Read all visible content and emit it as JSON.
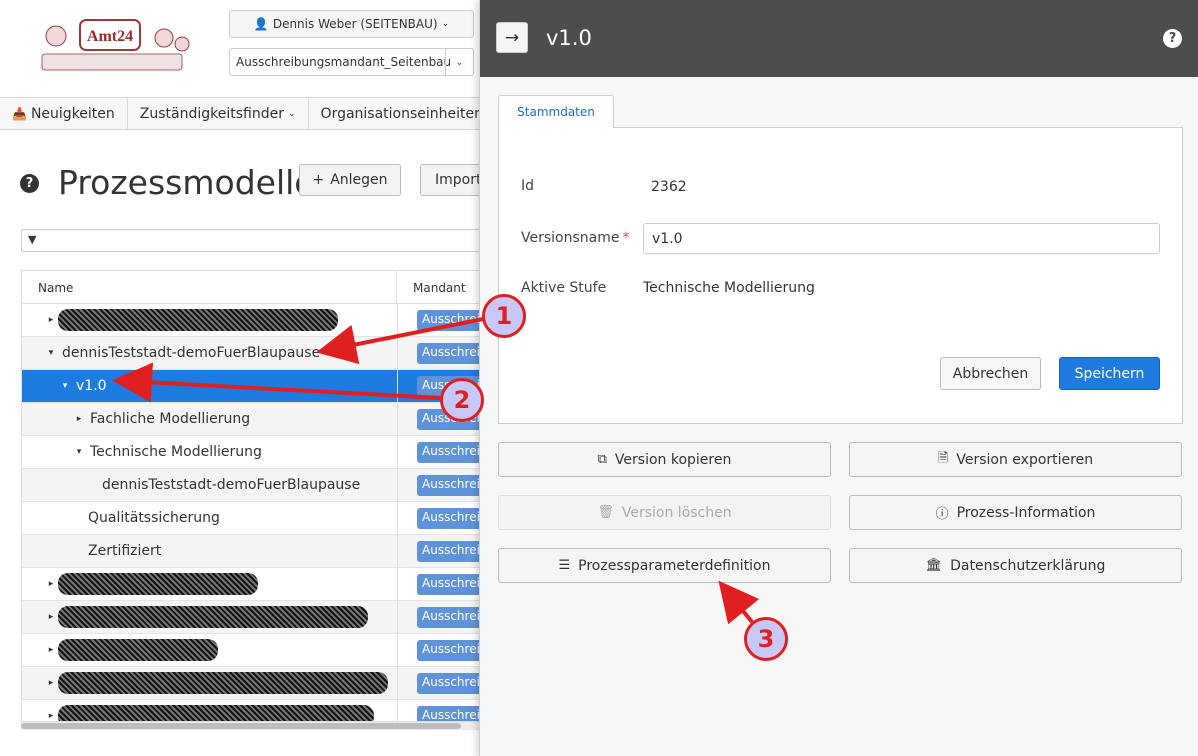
{
  "header": {
    "user_label": "Dennis Weber (SEITENBAU)",
    "mandant_value": "Ausschreibungsmandant_Seitenbau",
    "logo_text": "Amt24"
  },
  "nav": {
    "items": [
      {
        "label": "Neuigkeiten"
      },
      {
        "label": "Zuständigkeitsfinder"
      },
      {
        "label": "Organisationseinheiten"
      }
    ]
  },
  "page": {
    "title": "Prozessmodelle",
    "anlegen_label": "Anlegen",
    "import_label": "Import"
  },
  "tree": {
    "col_name": "Name",
    "col_mandant": "Mandant",
    "badge_label": "Ausschreibungsmandant",
    "rows": [
      {
        "label": "",
        "toggle": "▸"
      },
      {
        "label": "dennisTeststadt-demoFuerBlaupause",
        "toggle": "▾"
      },
      {
        "label": "v1.0",
        "toggle": "▾"
      },
      {
        "label": "Fachliche Modellierung",
        "toggle": "▸"
      },
      {
        "label": "Technische Modellierung",
        "toggle": "▾"
      },
      {
        "label": "dennisTeststadt-demoFuerBlaupause",
        "toggle": ""
      },
      {
        "label": "Qualitätssicherung",
        "toggle": ""
      },
      {
        "label": "Zertifiziert",
        "toggle": ""
      }
    ]
  },
  "panel": {
    "title": "v1.0",
    "tab_label": "Stammdaten",
    "id_label": "Id",
    "id_value": "2362",
    "versionsname_label": "Versionsname",
    "versionsname_value": "v1.0",
    "stufe_label": "Aktive Stufe",
    "stufe_value": "Technische Modellierung",
    "cancel_label": "Abbrechen",
    "save_label": "Speichern",
    "actions": {
      "kopieren": "Version kopieren",
      "exportieren": "Version exportieren",
      "loeschen": "Version löschen",
      "info": "Prozess-Information",
      "parameter": "Prozessparameterdefinition",
      "datenschutz": "Datenschutzerklärung"
    }
  },
  "annotations": {
    "marker_1": "1",
    "marker_2": "2",
    "marker_3": "3",
    "color": "#e02020"
  },
  "colors": {
    "accent": "#1e7be0",
    "badge": "#5f93d9",
    "panel_header": "#4d4d4d"
  }
}
